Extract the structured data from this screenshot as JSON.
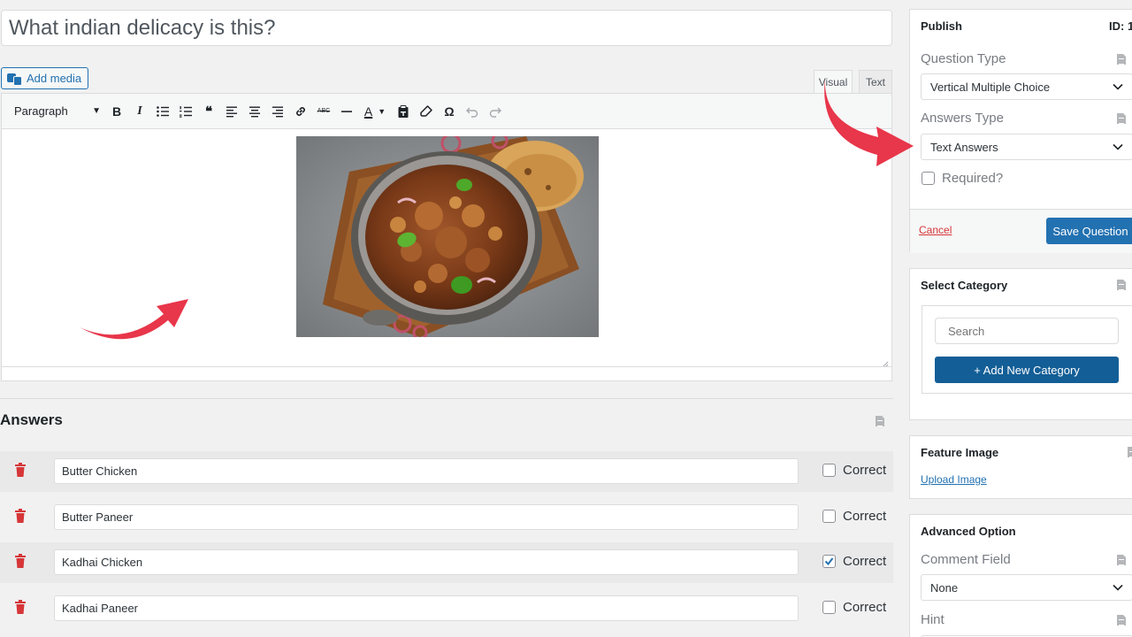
{
  "question": {
    "title": "What indian delicacy is this?"
  },
  "editor": {
    "add_media_label": "Add media",
    "tabs": {
      "visual": "Visual",
      "text": "Text"
    },
    "paragraph_format": "Paragraph",
    "toolbar_icons": [
      "bold-icon",
      "italic-icon",
      "bullet-list-icon",
      "numbered-list-icon",
      "blockquote-icon",
      "align-left-icon",
      "align-center-icon",
      "align-right-icon",
      "link-icon",
      "strikethrough-icon",
      "horizontal-line-icon",
      "text-color-icon",
      "paste-as-text-icon",
      "clear-formatting-icon",
      "special-character-icon",
      "undo-icon",
      "redo-icon"
    ],
    "toolbar_glyphs": {
      "bold": "B",
      "italic": "I",
      "blockquote": "66",
      "strikethrough": "ABC",
      "text_color": "A",
      "special_char": "Ω"
    }
  },
  "answers": {
    "title": "Answers",
    "correct_label": "Correct",
    "items": [
      {
        "text": "Butter Chicken",
        "correct": false
      },
      {
        "text": "Butter Paneer",
        "correct": false
      },
      {
        "text": "Kadhai Chicken",
        "correct": true
      },
      {
        "text": "Kadhai Paneer",
        "correct": false
      }
    ]
  },
  "publish": {
    "title": "Publish",
    "id_label": "ID: 1",
    "question_type_label": "Question Type",
    "question_type_value": "Vertical Multiple Choice",
    "answers_type_label": "Answers Type",
    "answers_type_value": "Text Answers",
    "required_label": "Required?",
    "required_checked": false,
    "cancel_label": "Cancel",
    "save_label": "Save Question"
  },
  "category": {
    "title": "Select Category",
    "search_placeholder": "Search",
    "add_button": "+ Add New Category"
  },
  "feature_image": {
    "title": "Feature Image",
    "upload_link": "Upload Image"
  },
  "advanced": {
    "title": "Advanced Option",
    "comment_field_label": "Comment Field",
    "comment_field_value": "None",
    "hint_label": "Hint"
  },
  "colors": {
    "primary": "#2271b1",
    "primary_dark": "#135e96",
    "danger": "#d63638",
    "arrow": "#e8364a"
  }
}
